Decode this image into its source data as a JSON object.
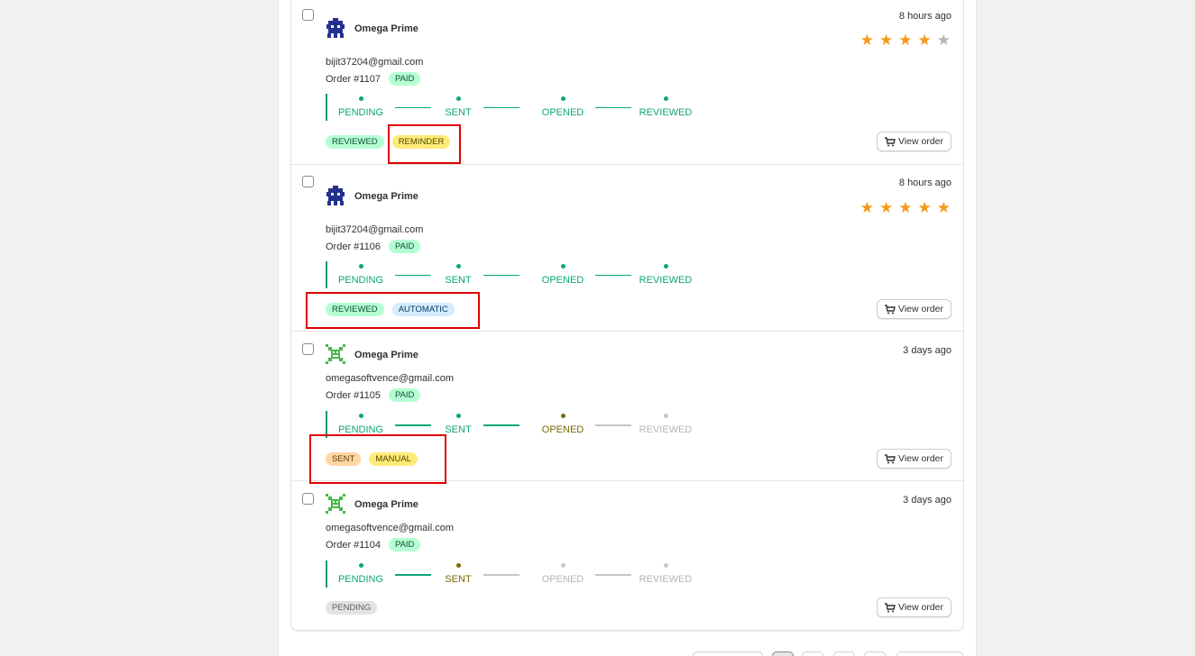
{
  "reviews": [
    {
      "name": "Omega Prime",
      "time": "8 hours ago",
      "rating": 4,
      "email": "bijit37204@gmail.com",
      "order": "Order #1107",
      "payment_badge": "PAID",
      "steps": [
        "PENDING",
        "SENT",
        "OPENED",
        "REVIEWED"
      ],
      "tags": [
        "REVIEWED",
        "REMINDER"
      ],
      "view_label": "View order"
    },
    {
      "name": "Omega Prime",
      "time": "8 hours ago",
      "rating": 5,
      "email": "bijit37204@gmail.com",
      "order": "Order #1106",
      "payment_badge": "PAID",
      "steps": [
        "PENDING",
        "SENT",
        "OPENED",
        "REVIEWED"
      ],
      "tags": [
        "REVIEWED",
        "AUTOMATIC"
      ],
      "view_label": "View order"
    },
    {
      "name": "Omega Prime",
      "time": "3 days ago",
      "email": "omegasoftvence@gmail.com",
      "order": "Order #1105",
      "payment_badge": "PAID",
      "steps": [
        "PENDING",
        "SENT",
        "OPENED",
        "REVIEWED"
      ],
      "tags": [
        "SENT",
        "MANUAL"
      ],
      "view_label": "View order"
    },
    {
      "name": "Omega Prime",
      "time": "3 days ago",
      "email": "omegasoftvence@gmail.com",
      "order": "Order #1104",
      "payment_badge": "PAID",
      "steps": [
        "PENDING",
        "SENT",
        "OPENED",
        "REVIEWED"
      ],
      "tags": [
        "PENDING"
      ],
      "view_label": "View order"
    }
  ],
  "colors": {
    "star_filled": "#f49a1a",
    "star_empty": "#b5b5b5",
    "step_done": "#0ba57a",
    "step_current": "#7a6a00",
    "step_todo": "#b5b5b5",
    "highlight_box": "#e00000"
  }
}
